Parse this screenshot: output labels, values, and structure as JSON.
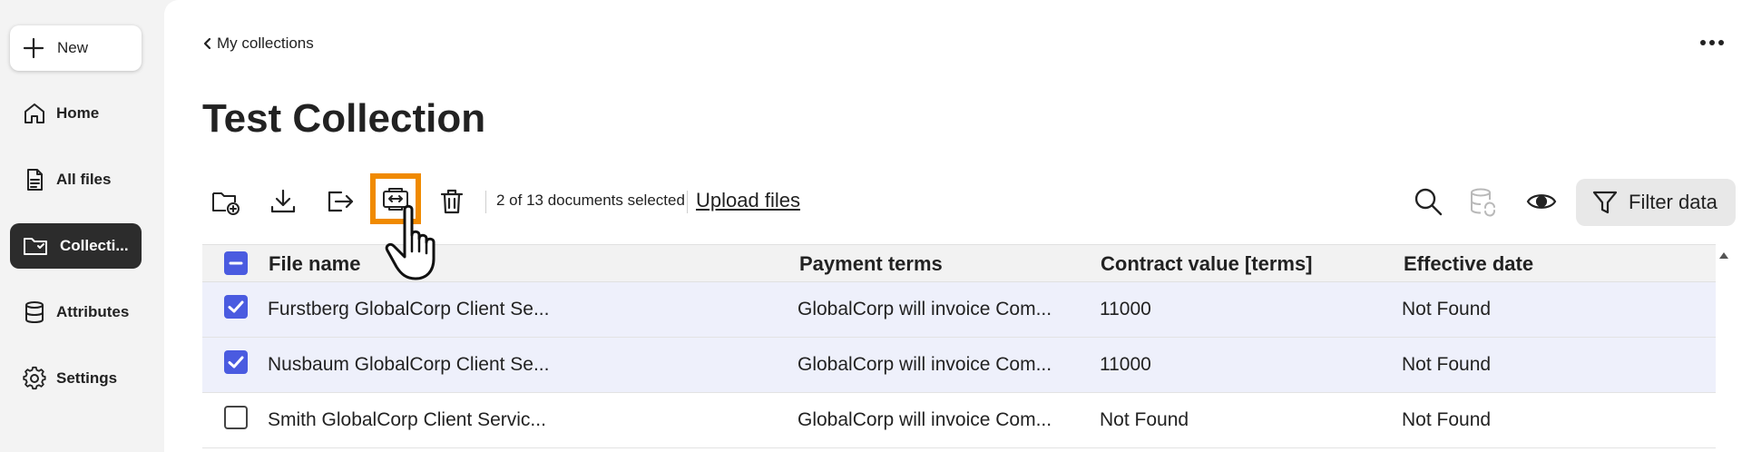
{
  "sidebar": {
    "new_label": "New",
    "items": [
      {
        "label": "Home",
        "icon": "home-icon"
      },
      {
        "label": "All files",
        "icon": "file-icon"
      },
      {
        "label": "Collecti...",
        "icon": "collection-icon",
        "active": true
      },
      {
        "label": "Attributes",
        "icon": "database-icon"
      },
      {
        "label": "Settings",
        "icon": "gear-icon"
      }
    ]
  },
  "header": {
    "breadcrumb": "My collections",
    "title": "Test Collection"
  },
  "toolbar": {
    "selected_text": "2 of 13 documents selected",
    "upload_label": "Upload files",
    "filter_label": "Filter data"
  },
  "table": {
    "columns": [
      "File name",
      "Payment terms",
      "Contract value [terms]",
      "Effective date"
    ],
    "rows": [
      {
        "checked": true,
        "file_name": "Furstberg GlobalCorp Client Se...",
        "payment_terms": "GlobalCorp will invoice Com...",
        "contract_value": "11000",
        "effective_date": "Not Found"
      },
      {
        "checked": true,
        "file_name": "Nusbaum GlobalCorp Client Se...",
        "payment_terms": "GlobalCorp will invoice Com...",
        "contract_value": "11000",
        "effective_date": "Not Found"
      },
      {
        "checked": false,
        "file_name": "Smith GlobalCorp Client Servic...",
        "payment_terms": "GlobalCorp will invoice Com...",
        "contract_value": "Not Found",
        "effective_date": "Not Found"
      }
    ]
  },
  "colors": {
    "accent": "#4a5be0",
    "highlight": "#f08a00",
    "active_nav": "#2c2c2c"
  }
}
